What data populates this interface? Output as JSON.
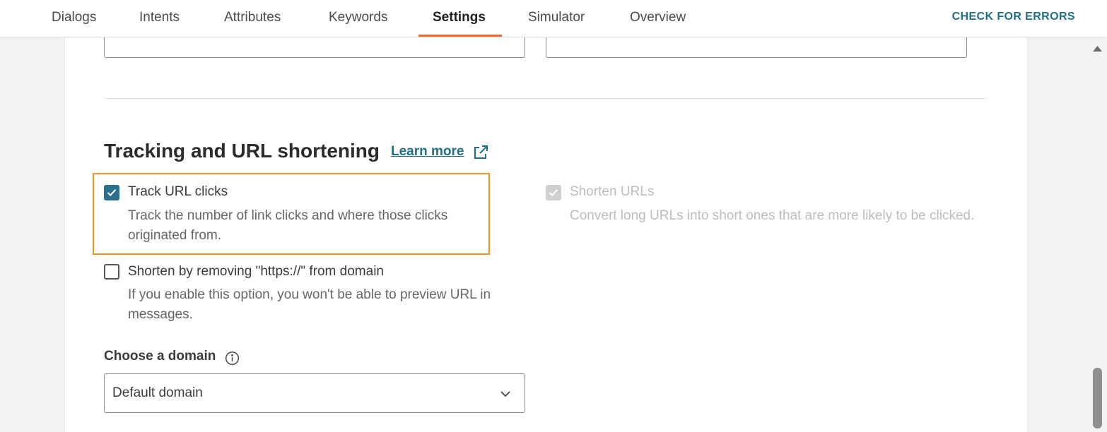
{
  "nav": {
    "tabs": [
      {
        "label": "Dialogs"
      },
      {
        "label": "Intents"
      },
      {
        "label": "Attributes"
      },
      {
        "label": "Keywords"
      },
      {
        "label": "Settings",
        "active": true
      },
      {
        "label": "Simulator"
      },
      {
        "label": "Overview"
      }
    ],
    "check_errors_label": "CHECK FOR ERRORS"
  },
  "section": {
    "title": "Tracking and URL shortening",
    "learn_more_label": "Learn more",
    "learn_more_icon": "external-link-icon"
  },
  "options": {
    "track_clicks": {
      "label": "Track URL clicks",
      "description": "Track the number of link clicks and where those clicks originated from.",
      "checked": true
    },
    "shorten_urls": {
      "label": "Shorten URLs",
      "description": "Convert long URLs into short ones that are more likely to be clicked.",
      "checked": true,
      "disabled": true
    },
    "remove_https": {
      "label": "Shorten by removing \"https://\" from domain",
      "description": "If you enable this option, you won't be able to preview URL in messages.",
      "checked": false
    }
  },
  "domain": {
    "label": "Choose a domain",
    "info_icon": "info-icon",
    "selected": "Default domain"
  },
  "colors": {
    "accent": "#1f6f8b",
    "active_tab_underline": "#f26a2b",
    "highlight_border": "#f0922b",
    "checkbox_checked": "#2a6f8d"
  }
}
